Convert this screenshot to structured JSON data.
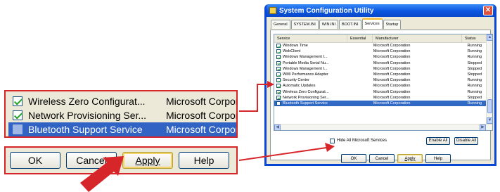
{
  "zoom": {
    "rows": [
      {
        "name": "Wireless Zero Configurat...",
        "manufacturer": "Microsoft Corporatio",
        "checked": true,
        "selected": false
      },
      {
        "name": "Network Provisioning Ser...",
        "manufacturer": "Microsoft Corporatio",
        "checked": true,
        "selected": false
      },
      {
        "name": "Bluetooth Support Service",
        "manufacturer": "Microsoft Corporatio",
        "checked": false,
        "selected": true
      }
    ],
    "buttons": {
      "ok": "OK",
      "cancel": "Cancel",
      "apply": "Apply",
      "help": "Help"
    }
  },
  "window": {
    "title": "System Configuration Utility",
    "close_glyph": "✕",
    "tabs": [
      "General",
      "SYSTEM.INI",
      "WIN.INI",
      "BOOT.INI",
      "Services",
      "Startup"
    ],
    "active_tab": "Services",
    "columns": {
      "service": "Service",
      "essential": "Essential",
      "manufacturer": "Manufacturer",
      "status": "Status"
    },
    "services": [
      {
        "name": "Windows Time",
        "manufacturer": "Microsoft Corporation",
        "status": "Running",
        "checked": true
      },
      {
        "name": "WebClient",
        "manufacturer": "Microsoft Corporation",
        "status": "Running",
        "checked": true
      },
      {
        "name": "Windows Management I...",
        "manufacturer": "Microsoft Corporation",
        "status": "Running",
        "checked": true
      },
      {
        "name": "Portable Media Serial Nu...",
        "manufacturer": "Microsoft Corporation",
        "status": "Stopped",
        "checked": true
      },
      {
        "name": "Windows Management I...",
        "manufacturer": "Microsoft Corporation",
        "status": "Stopped",
        "checked": true
      },
      {
        "name": "WMI Performance Adapter",
        "manufacturer": "Microsoft Corporation",
        "status": "Stopped",
        "checked": true
      },
      {
        "name": "Security Center",
        "manufacturer": "Microsoft Corporation",
        "status": "Running",
        "checked": true
      },
      {
        "name": "Automatic Updates",
        "manufacturer": "Microsoft Corporation",
        "status": "Running",
        "checked": true
      },
      {
        "name": "Wireless Zero Configurat...",
        "manufacturer": "Microsoft Corporation",
        "status": "Running",
        "checked": true
      },
      {
        "name": "Network Provisioning Ser...",
        "manufacturer": "Microsoft Corporation",
        "status": "Stopped",
        "checked": true
      },
      {
        "name": "Bluetooth Support Service",
        "manufacturer": "Microsoft Corporation",
        "status": "Running",
        "checked": false,
        "selected": true
      }
    ],
    "hide_ms_label": "Hide All Microsoft Services",
    "enable_all": "Enable All",
    "disable_all": "Disable All",
    "buttons": {
      "ok": "OK",
      "cancel": "Cancel",
      "apply": "Apply",
      "help": "Help"
    }
  },
  "colors": {
    "callout_border": "#d7262a",
    "selection": "#316ac5",
    "title_bar": "#0b56e0"
  }
}
